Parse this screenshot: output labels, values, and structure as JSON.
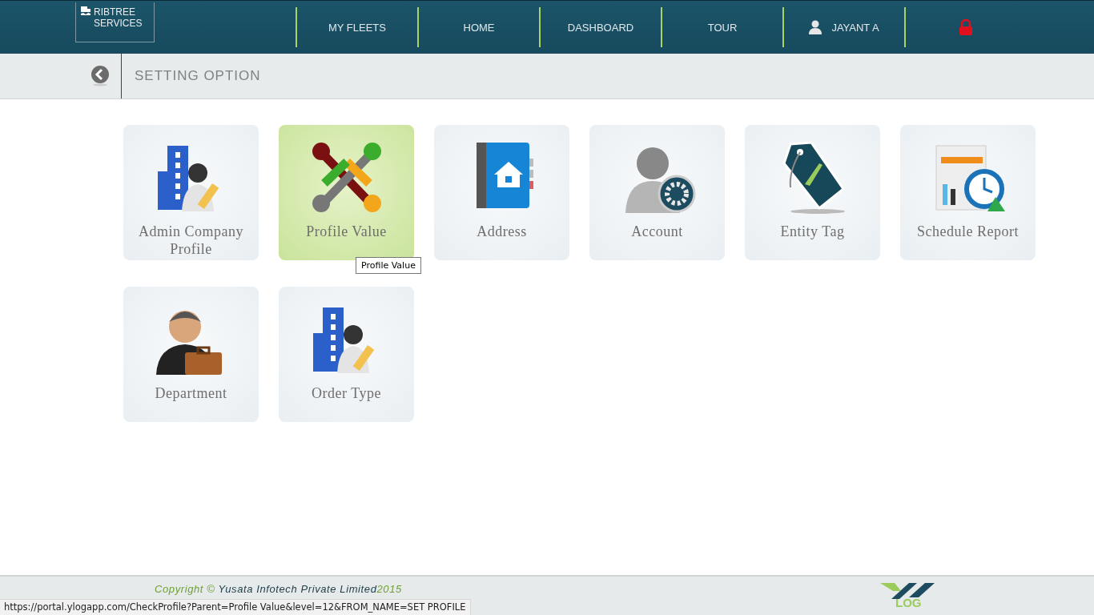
{
  "header": {
    "brand": [
      "RIBTREE",
      "SERVICES"
    ],
    "nav": [
      {
        "label": "MY FLEETS",
        "kind": "text"
      },
      {
        "label": "HOME",
        "kind": "text"
      },
      {
        "label": "DASHBOARD",
        "kind": "text"
      },
      {
        "label": "TOUR",
        "kind": "text"
      },
      {
        "label": "JAYANT A",
        "kind": "user"
      },
      {
        "kind": "lock"
      }
    ]
  },
  "subheader": {
    "title": "SETTING OPTION"
  },
  "cards": [
    {
      "label": "Admin Company Profile",
      "kind": "company",
      "selected": false
    },
    {
      "label": "Profile Value",
      "kind": "network",
      "selected": true
    },
    {
      "label": "Address",
      "kind": "addressbook",
      "selected": false
    },
    {
      "label": "Account",
      "kind": "account",
      "selected": false
    },
    {
      "label": "Entity Tag",
      "kind": "tag",
      "selected": false
    },
    {
      "label": "Schedule Report",
      "kind": "report",
      "selected": false
    },
    {
      "label": "Department",
      "kind": "department",
      "selected": false
    },
    {
      "label": "Order Type",
      "kind": "company",
      "selected": false
    }
  ],
  "tooltip": {
    "text": "Profile Value"
  },
  "footer": {
    "copyright_prefix": "Copyright ©",
    "company": "Yusata Infotech Private Limited",
    "year": "2015",
    "logo_text": "LOG"
  },
  "status_url": "https://portal.ylogapp.com/CheckProfile?Parent=Profile Value&level=12&FROM_NAME=SET PROFILE"
}
